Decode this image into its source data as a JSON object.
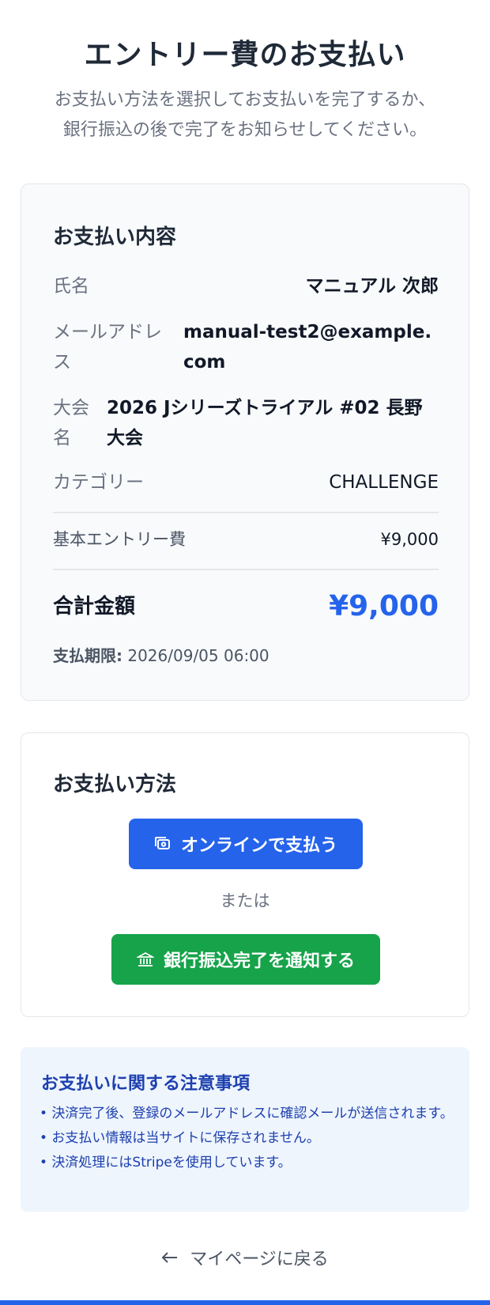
{
  "header": {
    "title": "エントリー費のお支払い",
    "subtitle_line1": "お支払い方法を選択してお支払いを完了するか、",
    "subtitle_line2": "銀行振込の後で完了をお知らせしてください。"
  },
  "summary": {
    "heading": "お支払い内容",
    "name_label": "氏名",
    "name_value": "マニュアル 次郎",
    "email_label": "メールアドレス",
    "email_value": "manual-test2@example.com",
    "event_label": "大会名",
    "event_value": "2026 Jシリーズトライアル #02 長野大会",
    "category_label": "カテゴリー",
    "category_value": "CHALLENGE",
    "base_fee_label": "基本エントリー費",
    "base_fee_value": "¥9,000",
    "total_label": "合計金額",
    "total_value": "¥9,000",
    "deadline_label": "支払期限:",
    "deadline_value": "2026/09/05 06:00"
  },
  "payment": {
    "heading": "お支払い方法",
    "online_button": "オンラインで支払う",
    "or_text": "または",
    "bank_button": "銀行振込完了を通知する"
  },
  "notice": {
    "title": "お支払いに関する注意事項",
    "items": [
      "• 決済完了後、登録のメールアドレスに確認メールが送信されます。",
      "• お支払い情報は当サイトに保存されません。",
      "• 決済処理にはStripeを使用しています。"
    ]
  },
  "footer": {
    "back_link": "マイページに戻る"
  },
  "colors": {
    "primary": "#2563eb",
    "success": "#16a34a",
    "notice_bg": "#eef5fd",
    "notice_text": "#1e40af"
  }
}
